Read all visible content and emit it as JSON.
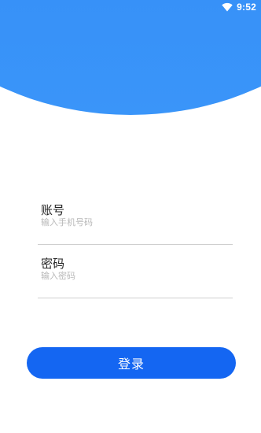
{
  "status_bar": {
    "time": "9:52",
    "wifi_icon": "wifi-icon"
  },
  "header": {
    "color": "#3a95f9"
  },
  "form": {
    "account": {
      "label": "账号",
      "placeholder": "输入手机号码",
      "value": ""
    },
    "password": {
      "label": "密码",
      "placeholder": "输入密码",
      "value": ""
    }
  },
  "login_button": {
    "label": "登录",
    "color": "#1466f2"
  }
}
